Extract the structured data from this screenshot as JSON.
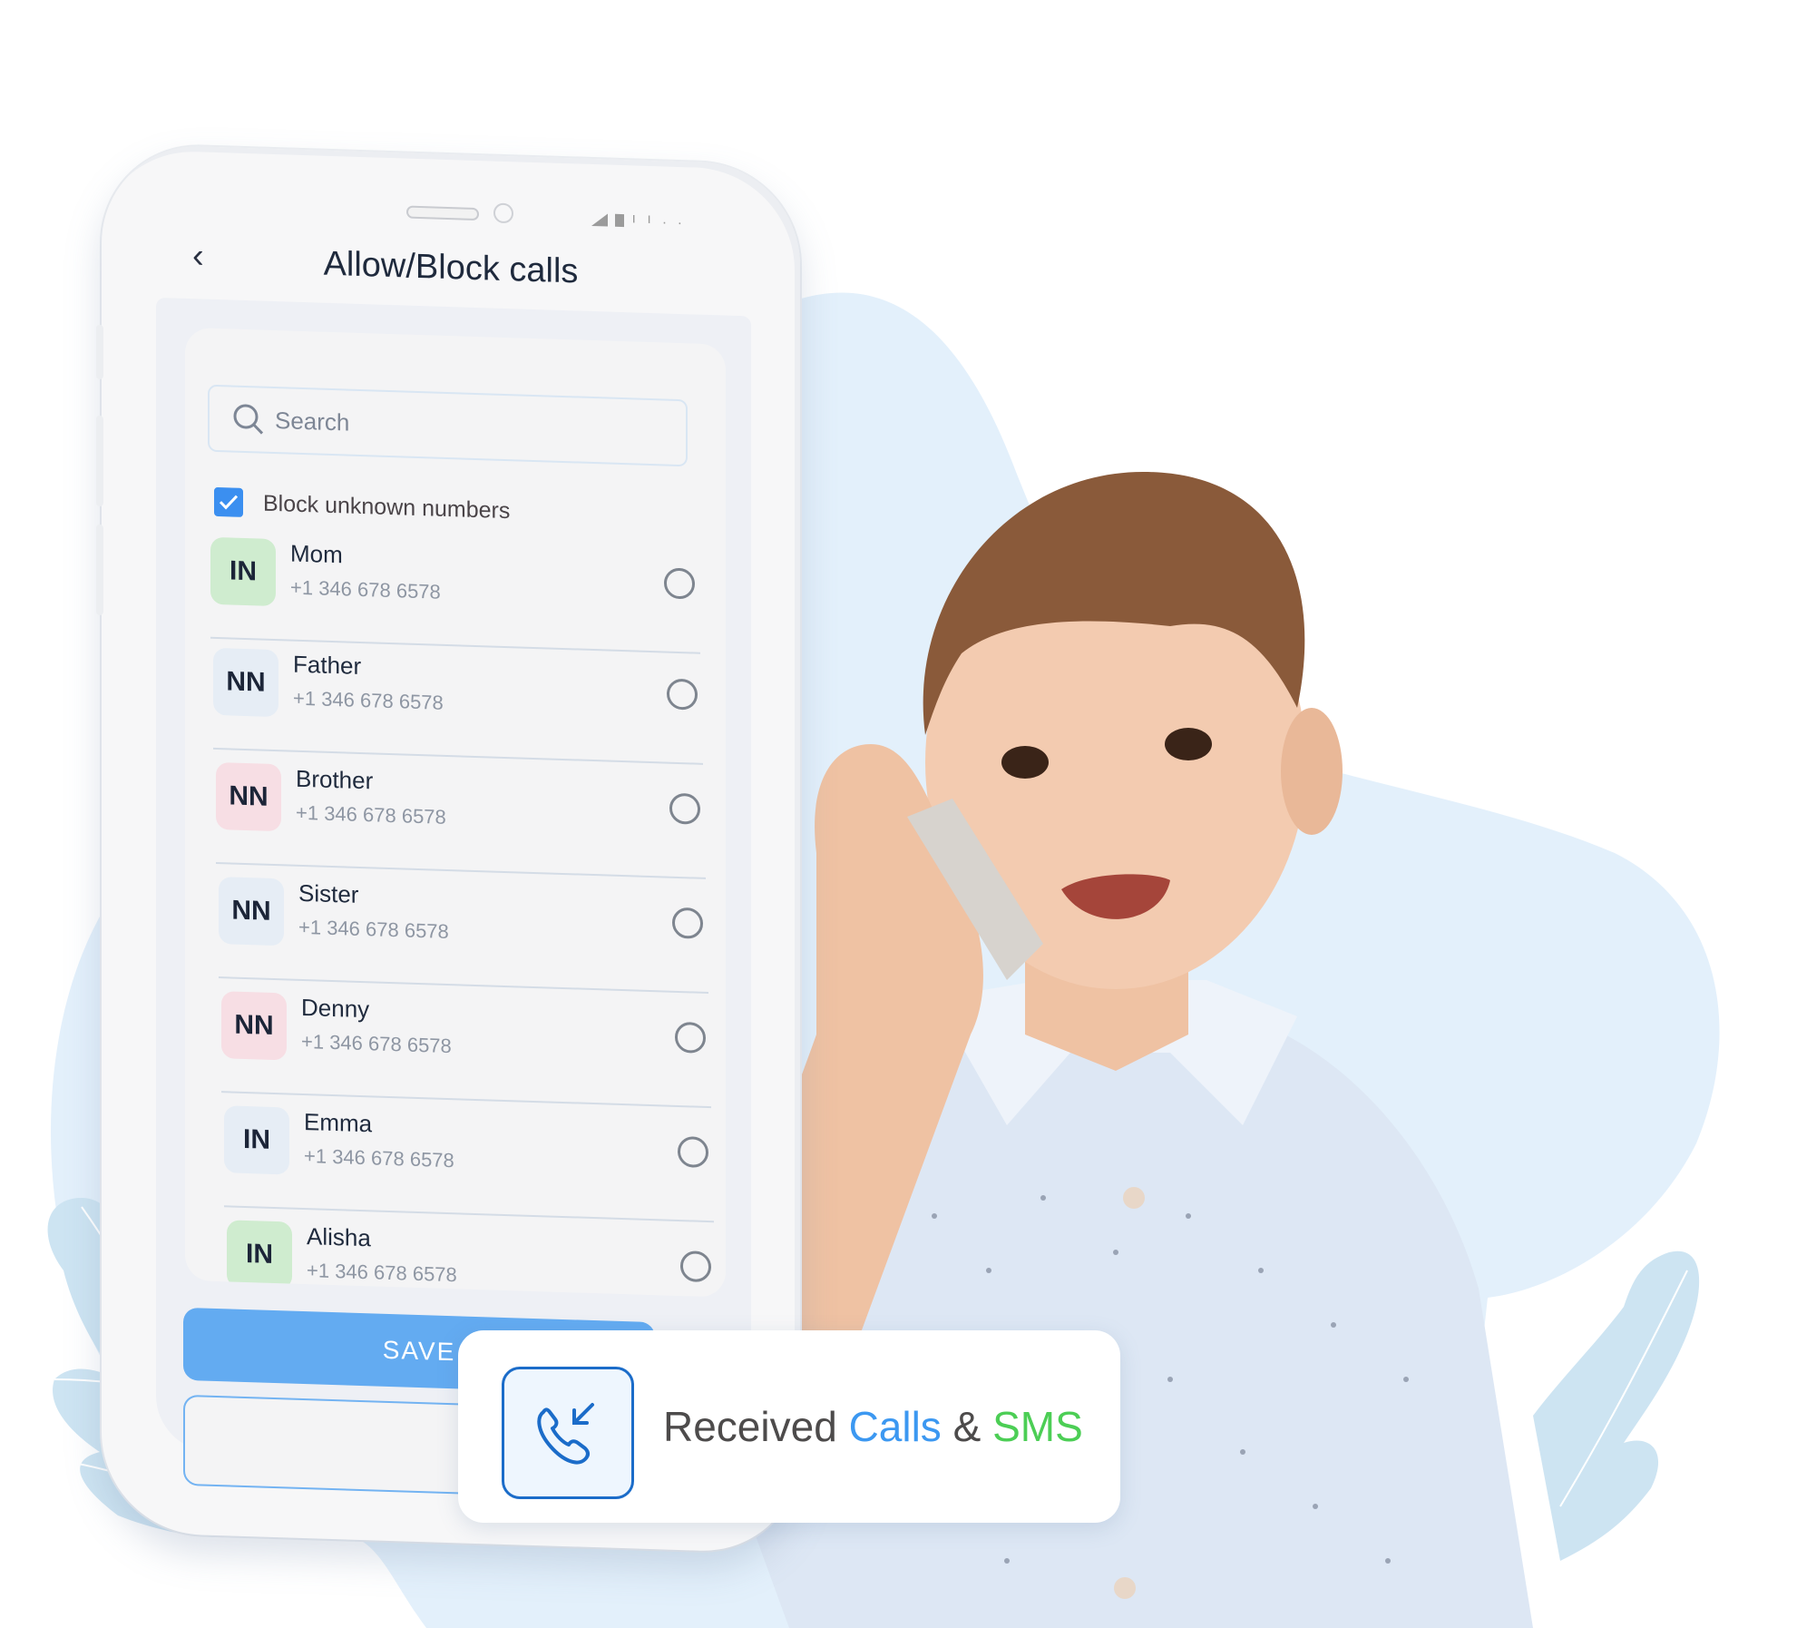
{
  "phone_screen": {
    "status_bar": {
      "icons": [
        "speaker-slot",
        "front-camera",
        "signal-icon",
        "battery-icon",
        "wifi-dots-icon"
      ]
    },
    "header": {
      "back_icon": "chevron-left-icon",
      "title": "Allow/Block calls"
    },
    "search": {
      "placeholder": "Search",
      "value": "",
      "icon": "search-icon"
    },
    "block_unknown": {
      "label": "Block unknown numbers",
      "checked": true
    },
    "contacts": [
      {
        "initials": "IN",
        "name": "Mom",
        "phone": "+1 346 678 6578",
        "avatar_color": "#cfeccf",
        "selected": false
      },
      {
        "initials": "NN",
        "name": "Father",
        "phone": "+1 346 678 6578",
        "avatar_color": "#e6edf5",
        "selected": false
      },
      {
        "initials": "NN",
        "name": "Brother",
        "phone": "+1 346 678 6578",
        "avatar_color": "#f7dee4",
        "selected": false
      },
      {
        "initials": "NN",
        "name": "Sister",
        "phone": "+1 346 678 6578",
        "avatar_color": "#e6edf5",
        "selected": false
      },
      {
        "initials": "NN",
        "name": "Denny",
        "phone": "+1 346 678 6578",
        "avatar_color": "#f7dee4",
        "selected": false
      },
      {
        "initials": "IN",
        "name": "Emma",
        "phone": "+1 346 678 6578",
        "avatar_color": "#e6edf5",
        "selected": false
      },
      {
        "initials": "IN",
        "name": "Alisha",
        "phone": "+1 346 678 6578",
        "avatar_color": "#cfeccf",
        "selected": false
      }
    ],
    "save_label": "SAVE",
    "secondary_button_label": ""
  },
  "feature_card": {
    "icon": "incoming-call-icon",
    "text_part1": "Received ",
    "text_part2": "Calls",
    "text_part3": " & ",
    "text_part4": "SMS",
    "colors": {
      "text": "#4d4b4b",
      "calls": "#3c98f1",
      "sms": "#4cce55",
      "icon": "#1b6cc9"
    }
  },
  "theme": {
    "blob": "#e3f0fb",
    "leaf": "#cde4f2",
    "save_button": "#63abf1",
    "checkbox": "#3b8ff0"
  }
}
